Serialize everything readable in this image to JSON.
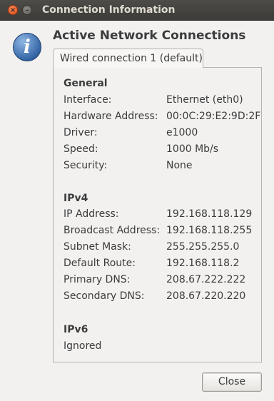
{
  "window": {
    "title": "Connection Information",
    "close_glyph": "×",
    "minimize_glyph": "–"
  },
  "icons": {
    "info": "i"
  },
  "main": {
    "heading": "Active Network Connections",
    "tab_label": "Wired connection 1 (default)"
  },
  "general": {
    "title": "General",
    "rows": [
      {
        "label": "Interface:",
        "value": "Ethernet (eth0)"
      },
      {
        "label": "Hardware Address:",
        "value": "00:0C:29:E2:9D:2F"
      },
      {
        "label": "Driver:",
        "value": "e1000"
      },
      {
        "label": "Speed:",
        "value": "1000 Mb/s"
      },
      {
        "label": "Security:",
        "value": "None"
      }
    ]
  },
  "ipv4": {
    "title": "IPv4",
    "rows": [
      {
        "label": "IP Address:",
        "value": "192.168.118.129"
      },
      {
        "label": "Broadcast Address:",
        "value": "192.168.118.255"
      },
      {
        "label": "Subnet Mask:",
        "value": "255.255.255.0"
      },
      {
        "label": "Default Route:",
        "value": "192.168.118.2"
      },
      {
        "label": "Primary DNS:",
        "value": "208.67.222.222"
      },
      {
        "label": "Secondary DNS:",
        "value": "208.67.220.220"
      }
    ]
  },
  "ipv6": {
    "title": "IPv6",
    "status": "Ignored"
  },
  "buttons": {
    "close": "Close"
  }
}
